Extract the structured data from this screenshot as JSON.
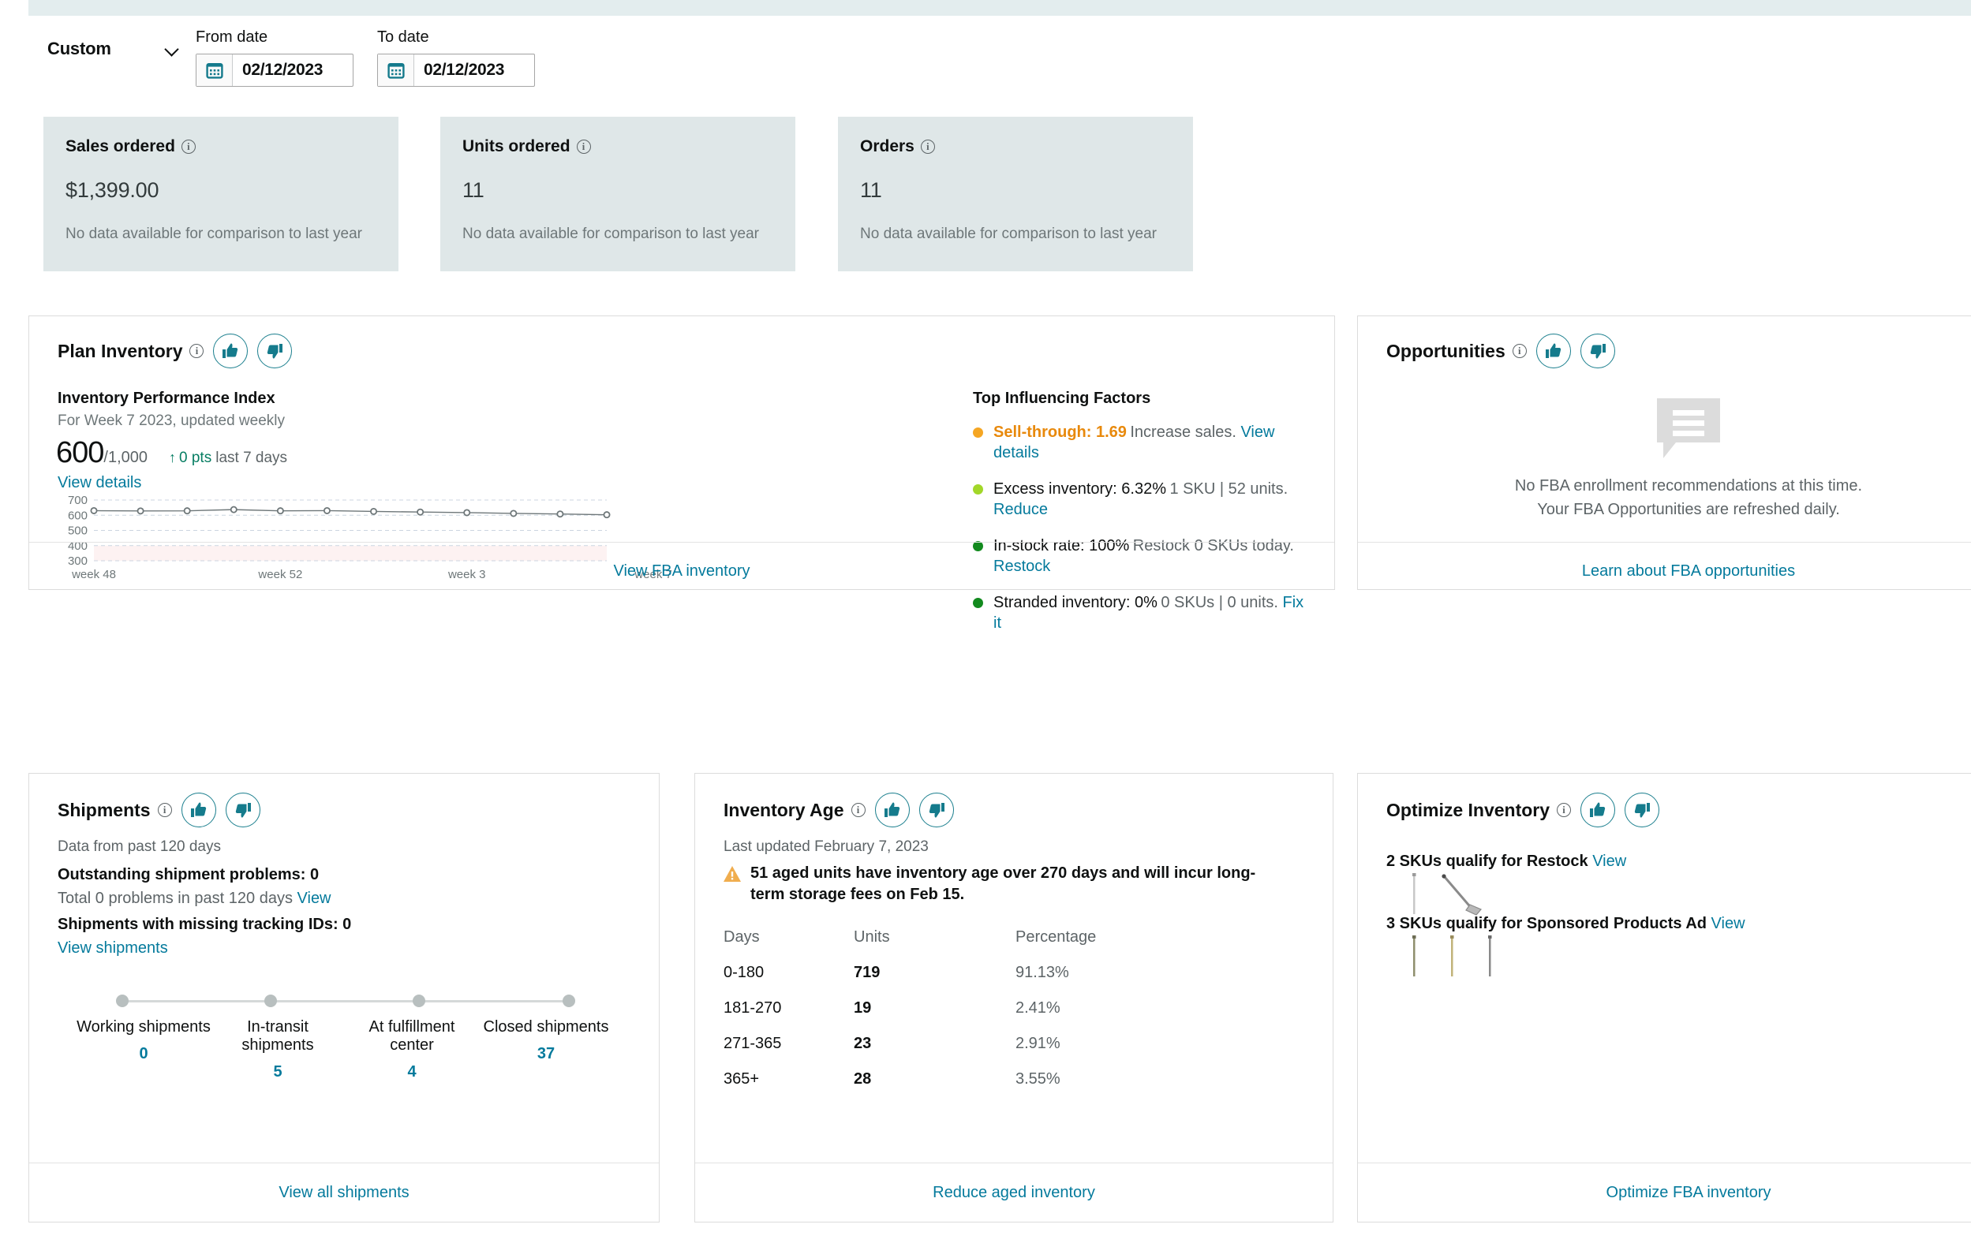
{
  "date_controls": {
    "range_label": "Custom",
    "from_label": "From date",
    "to_label": "To date",
    "from_value": "02/12/2023",
    "to_value": "02/12/2023"
  },
  "kpis": [
    {
      "title": "Sales ordered",
      "value": "$1,399.00",
      "sub": "No data available for comparison to last year"
    },
    {
      "title": "Units ordered",
      "value": "11",
      "sub": "No data available for comparison to last year"
    },
    {
      "title": "Orders",
      "value": "11",
      "sub": "No data available for comparison to last year"
    }
  ],
  "plan_inventory": {
    "title": "Plan Inventory",
    "ipi_title": "Inventory Performance Index",
    "ipi_sub": "For Week 7 2023, updated weekly",
    "score": "600",
    "score_den": "/1,000",
    "delta_arrow": "↑",
    "delta": "0 pts",
    "delta_note": "last 7 days",
    "view_details": "View details",
    "factors_title": "Top Influencing Factors",
    "factors": [
      {
        "main": "Sell-through: 1.69",
        "sub_text": "Increase sales.",
        "sub_link": "View details",
        "color": "#f5a623",
        "highlight": true
      },
      {
        "main": "Excess inventory: 6.32%",
        "sub_text": "1 SKU | 52 units.",
        "sub_link": "Reduce",
        "color": "#a2d729",
        "highlight": false
      },
      {
        "main": "In-stock rate: 100%",
        "sub_text": "Restock 0 SKUs today.",
        "sub_link": "Restock",
        "color": "#128a1e",
        "highlight": false
      },
      {
        "main": "Stranded inventory: 0%",
        "sub_text": "0 SKUs | 0 units.",
        "sub_link": "Fix it",
        "color": "#128a1e",
        "highlight": false
      }
    ],
    "footer_link": "View FBA inventory"
  },
  "chart_data": {
    "type": "line",
    "title": "Inventory Performance Index",
    "xlabel": "",
    "ylabel": "",
    "ylim": [
      300,
      700
    ],
    "yticks": [
      700,
      600,
      500,
      400,
      300
    ],
    "grid": true,
    "x_tick_labels": [
      "week 48",
      "week 52",
      "week 3",
      "week 7"
    ],
    "x_tick_positions": [
      0,
      4,
      8,
      12
    ],
    "x": [
      "week 48",
      "week 49",
      "week 50",
      "week 51",
      "week 52",
      "week 1",
      "week 2",
      "week 3",
      "week 4",
      "week 5",
      "week 6",
      "week 7"
    ],
    "values": [
      630,
      628,
      629,
      637,
      629,
      630,
      625,
      621,
      617,
      612,
      608,
      603
    ],
    "danger_band": [
      300,
      400
    ],
    "danger_band_color": "#fdf2f2",
    "line_color": "#6e7779",
    "marker": "circle"
  },
  "opportunities": {
    "title": "Opportunities",
    "empty_line1": "No FBA enrollment recommendations at this time.",
    "empty_line2": "Your FBA Opportunities are refreshed daily.",
    "footer_link": "Learn about FBA opportunities"
  },
  "shipments": {
    "title": "Shipments",
    "sub": "Data from past 120 days",
    "bold1": "Outstanding shipment problems: 0",
    "sub1_text": "Total 0 problems in past 120 days",
    "sub1_link": "View",
    "bold2": "Shipments with missing tracking IDs: 0",
    "sub2_link": "View shipments",
    "tracker": [
      {
        "label": "Working shipments",
        "value": "0"
      },
      {
        "label": "In-transit shipments",
        "value": "5"
      },
      {
        "label": "At fulfillment center",
        "value": "4"
      },
      {
        "label": "Closed shipments",
        "value": "37"
      }
    ],
    "footer_link": "View all shipments"
  },
  "inventory_age": {
    "title": "Inventory Age",
    "sub": "Last updated February 7, 2023",
    "alert": "51 aged units have inventory age over 270 days and will incur long-term storage fees on Feb 15.",
    "columns": [
      "Days",
      "Units",
      "Percentage"
    ],
    "rows": [
      {
        "days": "0-180",
        "units": "719",
        "percentage": "91.13%"
      },
      {
        "days": "181-270",
        "units": "19",
        "percentage": "2.41%"
      },
      {
        "days": "271-365",
        "units": "23",
        "percentage": "2.91%"
      },
      {
        "days": "365+",
        "units": "28",
        "percentage": "3.55%"
      }
    ],
    "footer_link": "Reduce aged inventory"
  },
  "optimize_inventory": {
    "title": "Optimize Inventory",
    "line1_text": "2 SKUs qualify for Restock",
    "line1_link": "View",
    "line2_text": "3 SKUs qualify for Sponsored Products Ad",
    "line2_link": "View",
    "footer_link": "Optimize FBA inventory"
  },
  "colors": {
    "accent_link": "#047a9c",
    "teal": "#1b7f8e",
    "kpi_bg": "#dfe7e8",
    "strip": "#e3edee"
  }
}
